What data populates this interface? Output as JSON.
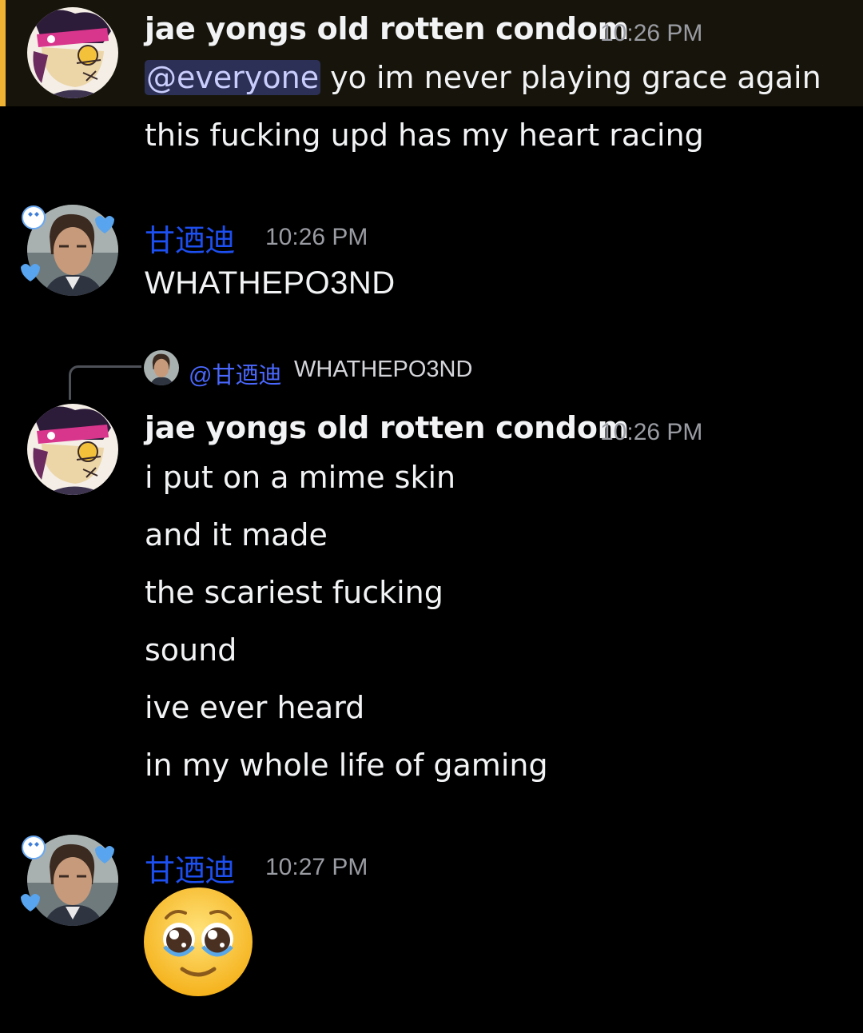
{
  "colors": {
    "highlight_background": "#17150b",
    "highlight_bar": "#f0b232",
    "username_cn": "#1d4ff0",
    "mention_bg": "#2c3057",
    "mention_text": "#c9cdfb",
    "timestamp": "#9a9ca3"
  },
  "messages": [
    {
      "author": "jae yongs old rotten condom",
      "time": "10:26 PM",
      "avatar": "cartoon-avatar-icon",
      "highlighted": true,
      "mention": "@everyone",
      "mention_rest": " yo im never playing grace again",
      "lines": [
        "this fucking upd has my heart racing"
      ]
    },
    {
      "author": "甘迺迪",
      "time": "10:26 PM",
      "avatar": "man-avatar-icon",
      "lines": [
        "WHATHEPO3ND"
      ]
    },
    {
      "reply": {
        "mention": "@甘迺迪",
        "text": "WHATHEPO3ND",
        "avatar": "man-avatar-icon"
      },
      "author": "jae yongs old rotten condom",
      "time": "10:26 PM",
      "avatar": "cartoon-avatar-icon",
      "lines": [
        "i put on a mime skin",
        "and it made",
        "the scariest fucking",
        "sound",
        "ive ever heard",
        "in my whole life of gaming"
      ]
    },
    {
      "author": "甘迺迪",
      "time": "10:27 PM",
      "avatar": "man-avatar-icon",
      "emoji": "pleading-face-emoji"
    }
  ]
}
